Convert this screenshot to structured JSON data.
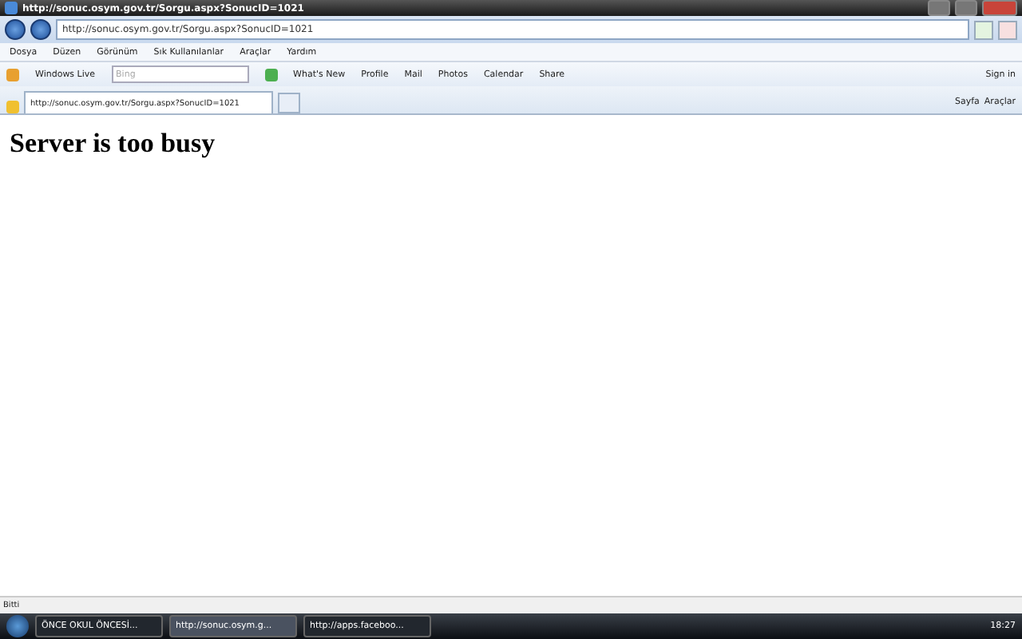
{
  "window": {
    "title": "http://sonuc.osym.gov.tr/Sorgu.aspx?SonucID=1021"
  },
  "address_bar": {
    "value": "http://sonuc.osym.gov.tr/Sorgu.aspx?SonucID=1021"
  },
  "menu": [
    "Dosya",
    "Düzen",
    "Görünüm",
    "Sık Kullanılanlar",
    "Araçlar",
    "Yardım"
  ],
  "toolbar": {
    "brand": "Windows Live",
    "search": {
      "placeholder": "Bing"
    },
    "links": [
      "What's New",
      "Profile",
      "Mail",
      "Photos",
      "Calendar",
      "Share"
    ],
    "sign_in": "Sign in"
  },
  "tabs": [
    {
      "label": "http://sonuc.osym.gov.tr/Sorgu.aspx?SonucID=1021",
      "selected": true
    }
  ],
  "command_bar": [
    "Sayfa",
    "Araçlar"
  ],
  "page": {
    "heading": "Server is too busy"
  },
  "status_bar": "Bitti",
  "taskbar": {
    "items": [
      {
        "label": "ÖNCE OKUL ÖNCESİ...",
        "selected": false
      },
      {
        "label": "http://sonuc.osym.g...",
        "selected": true
      },
      {
        "label": "http://apps.faceboo...",
        "selected": false
      }
    ],
    "clock": "18:27"
  }
}
